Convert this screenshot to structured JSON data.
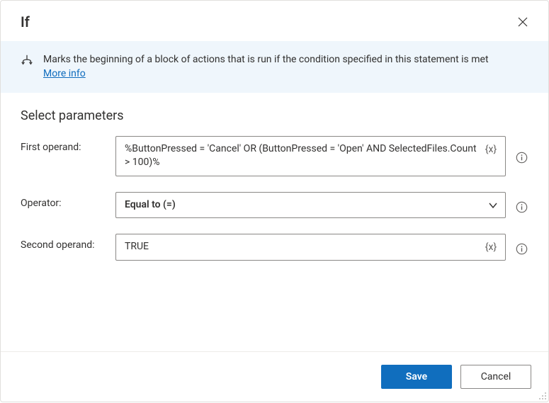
{
  "dialog": {
    "title": "If"
  },
  "banner": {
    "description": "Marks the beginning of a block of actions that is run if the condition specified in this statement is met",
    "link_label": "More info"
  },
  "parameters": {
    "heading": "Select parameters",
    "first_operand": {
      "label": "First operand:",
      "value": "%ButtonPressed = 'Cancel' OR (ButtonPressed = 'Open' AND SelectedFiles.Count > 100)%",
      "variable_token": "{x}"
    },
    "operator": {
      "label": "Operator:",
      "value": "Equal to (=)"
    },
    "second_operand": {
      "label": "Second operand:",
      "value": "TRUE",
      "variable_token": "{x}"
    }
  },
  "footer": {
    "save_label": "Save",
    "cancel_label": "Cancel"
  }
}
